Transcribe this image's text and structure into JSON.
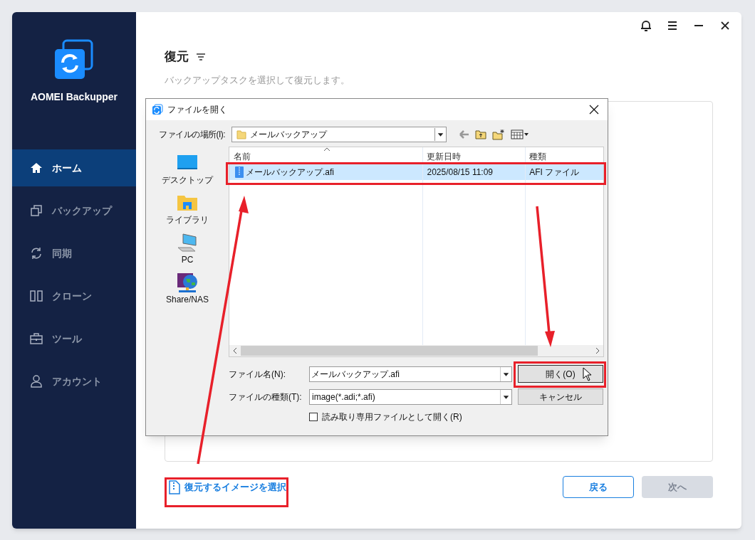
{
  "app": {
    "name": "AOMEI Backupper"
  },
  "sidebar": {
    "items": [
      {
        "kind": "home",
        "label": "ホーム",
        "selected": true
      },
      {
        "kind": "backup",
        "label": "バックアップ",
        "selected": false
      },
      {
        "kind": "sync",
        "label": "同期",
        "selected": false
      },
      {
        "kind": "clone",
        "label": "クローン",
        "selected": false
      },
      {
        "kind": "tools",
        "label": "ツール",
        "selected": false
      },
      {
        "kind": "account",
        "label": "アカウント",
        "selected": false
      }
    ]
  },
  "main": {
    "title": "復元",
    "subtitle": "バックアップタスクを選択して復元します。",
    "select_image_link": "復元するイメージを選択",
    "buttons": [
      {
        "label": "戻る",
        "disabled": false
      },
      {
        "label": "次へ",
        "disabled": true
      }
    ]
  },
  "dialog": {
    "title": "ファイルを開く",
    "location_label": "ファイルの場所(I):",
    "location_value": "メールバックアップ",
    "places": [
      {
        "kind": "desktop",
        "label": "デスクトップ"
      },
      {
        "kind": "library",
        "label": "ライブラリ"
      },
      {
        "kind": "pc",
        "label": "PC"
      },
      {
        "kind": "network",
        "label": "Share/NAS"
      }
    ],
    "columns": [
      "名前",
      "更新日時",
      "種類"
    ],
    "files": [
      {
        "name": "メールバックアップ.afi",
        "modified": "2025/08/15 11:09",
        "type": "AFI ファイル",
        "selected": true
      }
    ],
    "filename_label": "ファイル名(N):",
    "filename_value": "メールバックアップ.afi",
    "filetype_label": "ファイルの種類(T):",
    "filetype_value": "image(*.adi;*.afi)",
    "open_button": "開く(O)",
    "cancel_button": "キャンセル",
    "readonly": {
      "label": "読み取り専用ファイルとして開く(R)",
      "checked": false
    }
  }
}
